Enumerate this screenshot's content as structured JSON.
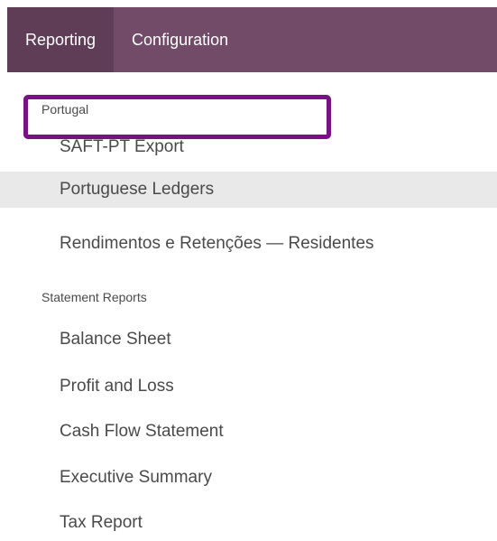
{
  "topbar": {
    "tabs": [
      {
        "label": "Reporting"
      },
      {
        "label": "Configuration"
      }
    ]
  },
  "menu": {
    "sections": [
      {
        "header": "Portugal",
        "items": [
          {
            "label": "SAFT-PT Export"
          },
          {
            "label": "Portuguese Ledgers"
          },
          {
            "label": "Rendimentos e Retenções — Residentes"
          }
        ]
      },
      {
        "header": "Statement Reports",
        "items": [
          {
            "label": "Balance Sheet"
          },
          {
            "label": "Profit and Loss"
          },
          {
            "label": "Cash Flow Statement"
          },
          {
            "label": "Executive Summary"
          },
          {
            "label": "Tax Report"
          }
        ]
      }
    ]
  },
  "colors": {
    "topbar": "#714b67",
    "active_tab": "#5f3d57",
    "highlight_border": "#7a0f87",
    "hover_row": "#e9e9e9"
  }
}
